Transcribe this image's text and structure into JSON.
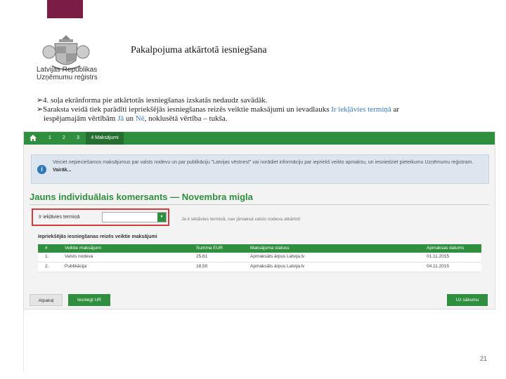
{
  "slide": {
    "title": "Pakalpojuma atkārtotā iesniegšana",
    "logo_text_line1": "Latvijas Republikas",
    "logo_text_line2": "Uzņēmumu reģistrs",
    "bullet1": "4. soļa ekrānforma pie atkārtotās iesniegšanas izskatās nedaudz savādāk.",
    "bullet2_part1": "Saraksta veidā tiek parādīti iepriekšējās iesniegšanas reizēs veiktie maksājumi un ievadlauks ",
    "bullet2_kw": "Ir iekļāvies termiņā",
    "bullet2_part2": " ar",
    "bullet2_line2_part1": "iespējamajām vērtībām ",
    "bullet2_val_ja": "Jā",
    "bullet2_line2_part2": " un ",
    "bullet2_val_ne": "Nē",
    "bullet2_line2_part3": ", noklusētā vērtība – tukša.",
    "page_number": "21"
  },
  "nav": {
    "home_icon": "home-icon",
    "steps": [
      "1",
      "2",
      "3",
      "4 Maksājumi"
    ]
  },
  "info": {
    "text": "Veiciet nepieciešamos maksājumus par valsts nodevu un par publikāciju \"Latvijas vēstnesī\" vai norādiet informāciju par iepriekš veikto apmaksu, un iesniedziet pieteikumu Uzņēmumu reģistram.",
    "more": "Vairāk..."
  },
  "form": {
    "heading": "Jauns individuālais komersants — Novembra migla",
    "field_label": "Ir iekļāvies termiņā",
    "select_value": "",
    "hint": "Ja ir iekļāvies termiņā, nav jāmaksā valsts nodeva atkārtoti"
  },
  "table": {
    "title": "Iepriekšējās iesniegšanas reizēs veiktie maksājumi",
    "headers": [
      "#",
      "Veiktie maksājumi",
      "Summa EUR",
      "Maksājuma statuss",
      "Apmaksas datums"
    ],
    "rows": [
      [
        "1.",
        "Valsts nodeva",
        "25,61",
        "Apmaksāts ārpus Latvija.lv",
        "01.11.2015"
      ],
      [
        "2.",
        "Publikācija",
        "18,50",
        "Apmaksāts ārpus Latvija.lv",
        "04.11.2015"
      ]
    ]
  },
  "buttons": {
    "back": "Atpakaļ",
    "submit": "Iesniegt UR",
    "save": "Uz sākumu"
  },
  "colors": {
    "brand_green": "#2f8f3e",
    "accent_maroon": "#7b1c45",
    "highlight_red": "#d23b3b",
    "keyword_blue": "#3b7bc0"
  }
}
